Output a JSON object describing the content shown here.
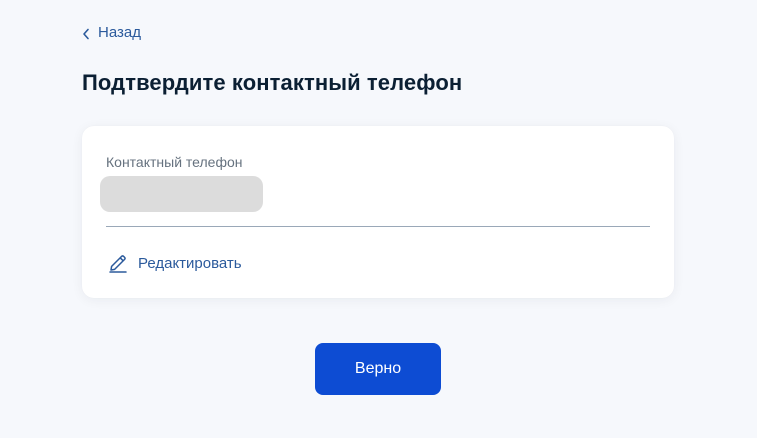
{
  "nav": {
    "back_label": "Назад"
  },
  "header": {
    "title": "Подтвердите контактный телефон"
  },
  "card": {
    "field_label": "Контактный телефон",
    "field_value": "",
    "edit_label": "Редактировать"
  },
  "actions": {
    "confirm_label": "Верно"
  },
  "icons": {
    "back": "chevron-left-icon",
    "edit": "pencil-icon"
  },
  "colors": {
    "accent": "#0d4cd3",
    "link": "#2b5a9c",
    "title": "#0b1f33",
    "muted": "#66727f",
    "masked": "#dcdcdc",
    "background": "#f6f8fc"
  }
}
